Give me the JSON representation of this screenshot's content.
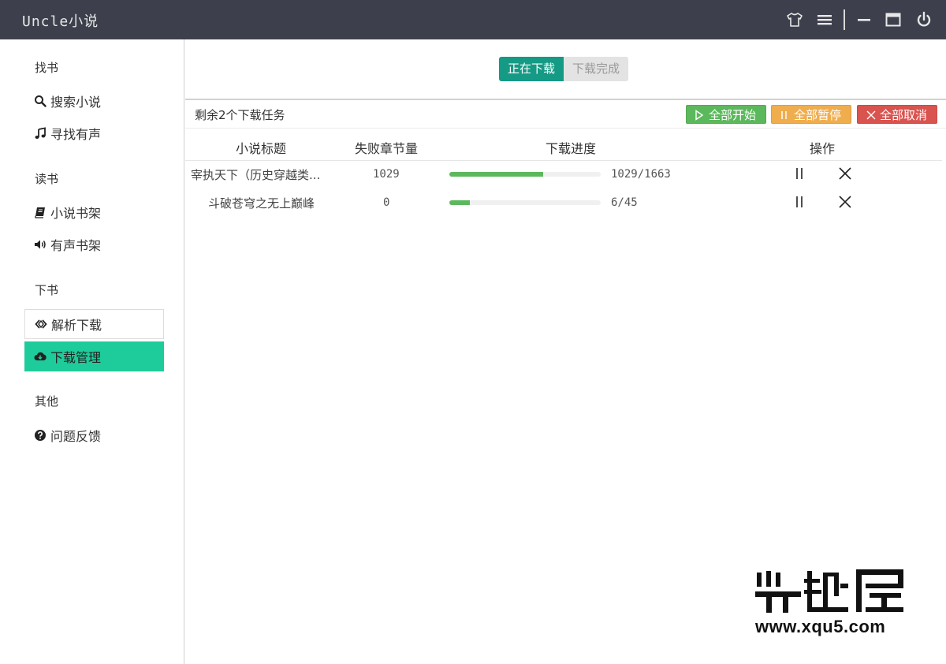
{
  "app": {
    "title": "Uncle小说"
  },
  "titlebar_icons": [
    "shirt-icon",
    "menu-icon",
    "minimize-icon",
    "maximize-icon",
    "power-icon"
  ],
  "sidebar": {
    "groups": [
      {
        "title": "找书",
        "items": [
          {
            "label": "搜索小说",
            "icon": "search-icon"
          },
          {
            "label": "寻找有声",
            "icon": "music-icon"
          }
        ]
      },
      {
        "title": "读书",
        "items": [
          {
            "label": "小说书架",
            "icon": "book-icon"
          },
          {
            "label": "有声书架",
            "icon": "volume-icon"
          }
        ]
      },
      {
        "title": "下书",
        "items": [
          {
            "label": "解析下载",
            "icon": "code-icon"
          },
          {
            "label": "下载管理",
            "icon": "cloud-download-icon",
            "active": true
          }
        ]
      },
      {
        "title": "其他",
        "items": [
          {
            "label": "问题反馈",
            "icon": "question-icon"
          }
        ]
      }
    ]
  },
  "tabs": [
    {
      "label": "正在下载",
      "active": true
    },
    {
      "label": "下载完成",
      "active": false
    }
  ],
  "toolbar": {
    "remaining": "剩余2个下载任务",
    "start_all": "全部开始",
    "pause_all": "全部暂停",
    "cancel_all": "全部取消"
  },
  "table": {
    "headers": [
      "小说标题",
      "失败章节量",
      "下载进度",
      "操作"
    ],
    "rows": [
      {
        "title": "宰执天下（历史穿越类...",
        "failed": "1029",
        "progress_text": "1029/1663",
        "progress": 0.619
      },
      {
        "title": "斗破苍穹之无上巅峰",
        "failed": "0",
        "progress_text": "6/45",
        "progress": 0.133
      }
    ]
  },
  "colors": {
    "titlebar": "#3d404c",
    "tab_active": "#149a85",
    "sidebar_active": "#1ecc9b",
    "btn_start": "#5cb85c",
    "btn_pause": "#f0ad4e",
    "btn_cancel": "#d9534f",
    "progress": "#5cb85c"
  },
  "watermark": {
    "logo_text": "兴趣屋",
    "url": "www.xqu5.com"
  }
}
